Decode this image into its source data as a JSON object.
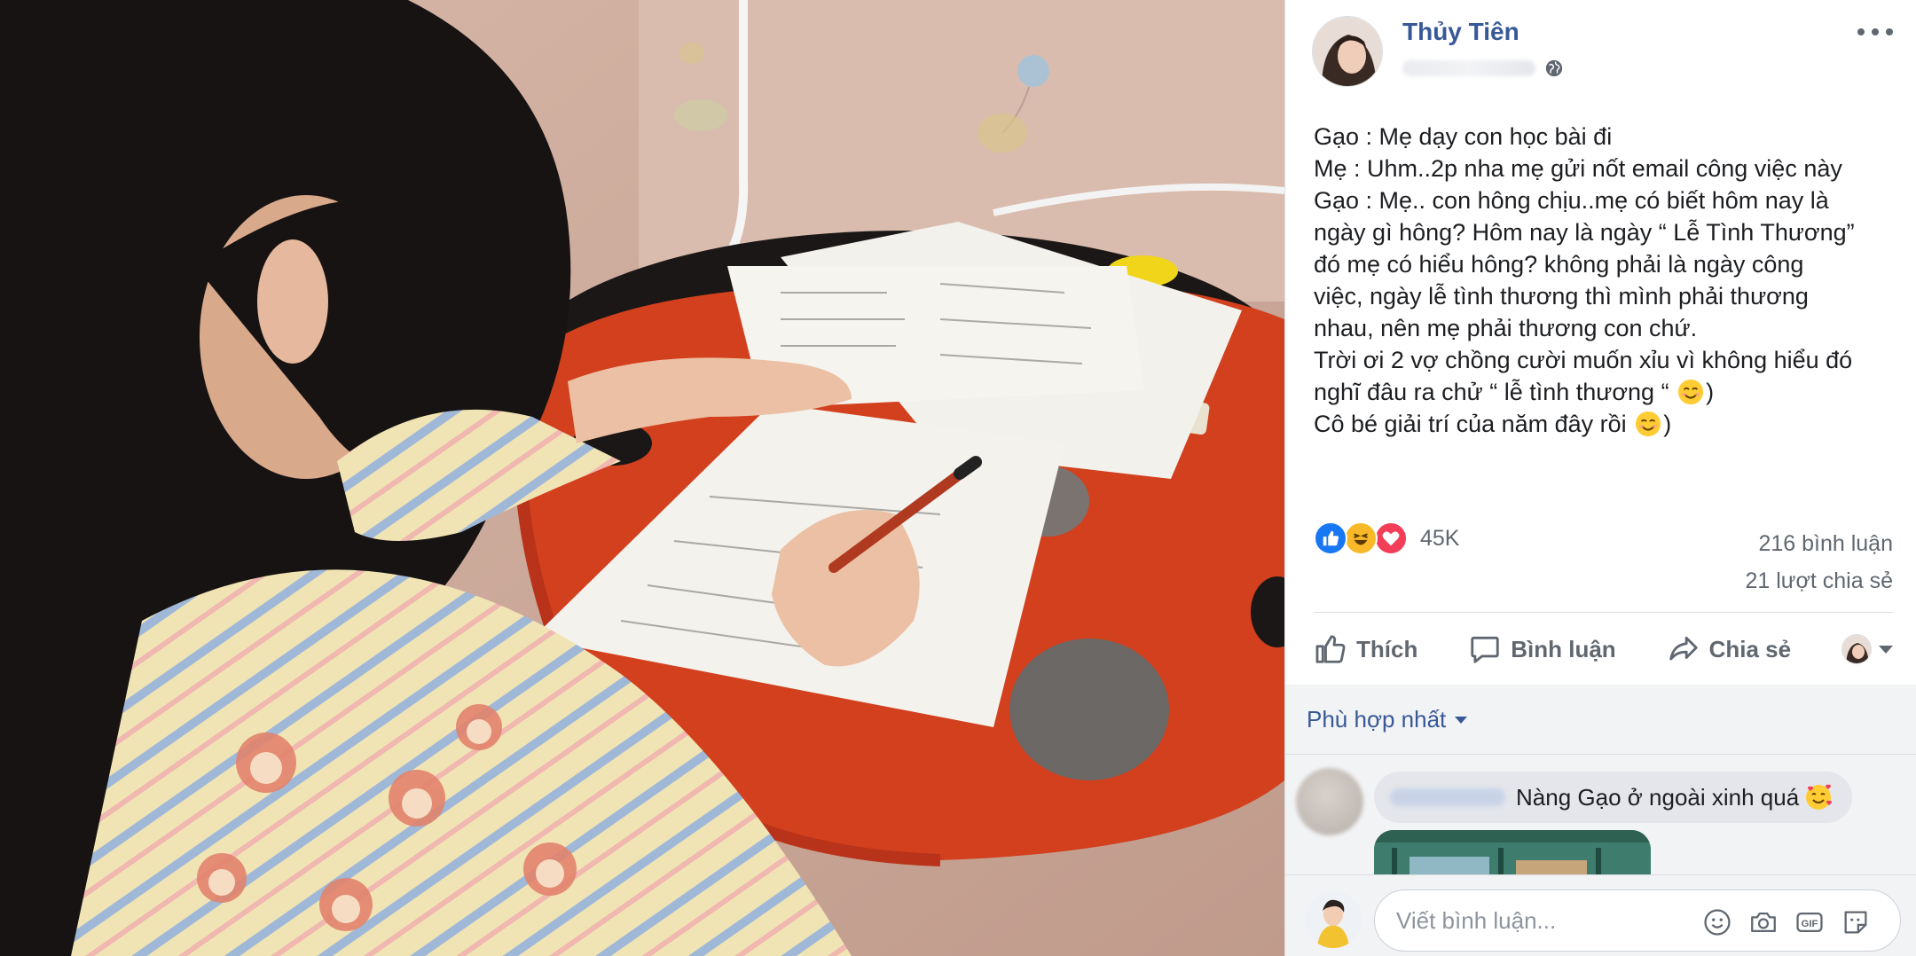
{
  "post": {
    "author": "Thủy Tiên",
    "privacy_icon": "globe-icon",
    "more_icon": "more-options-icon",
    "lines": [
      "Gạo : Mẹ dạy con học bài đi",
      "Mẹ : Uhm..2p nha mẹ gửi nốt email công việc này",
      "Gạo : Mẹ.. con hông chịu..mẹ có biết hôm nay là",
      "ngày gì hông? Hôm nay là ngày “ Lễ Tình Thương”",
      "đó mẹ có hiểu hông? không phải là ngày công",
      "việc, ngày lễ tình thương thì mình phải thương",
      "nhau, nên mẹ phải thương con chứ.",
      "Trời ơi 2 vợ chồng cười muốn xỉu vì không hiểu đó",
      "nghĩ đâu ra chử “ lễ tình thương “",
      "Cô bé giải trí của năm đây rồi"
    ],
    "line9_suffix": ")",
    "line10_suffix": ")"
  },
  "reactions": {
    "icons": [
      "like-reaction-icon",
      "haha-reaction-icon",
      "love-reaction-icon"
    ],
    "count": "45K",
    "comments": "216 bình luận",
    "shares": "21 lượt chia sẻ"
  },
  "actions": {
    "like": "Thích",
    "comment": "Bình luận",
    "share": "Chia sẻ"
  },
  "comments": {
    "sort_label": "Phù hợp nhất",
    "first_comment_text": "Nàng Gạo ở ngoài xinh quá"
  },
  "composer": {
    "placeholder": "Viết bình luận...",
    "icons": [
      "emoji-icon",
      "camera-icon",
      "gif-icon",
      "sticker-icon"
    ]
  },
  "colors": {
    "link_blue": "#385898",
    "secondary_text": "#606770",
    "like_blue": "#1877f2",
    "love_red": "#f33e58",
    "haha_yellow": "#f7b928"
  }
}
